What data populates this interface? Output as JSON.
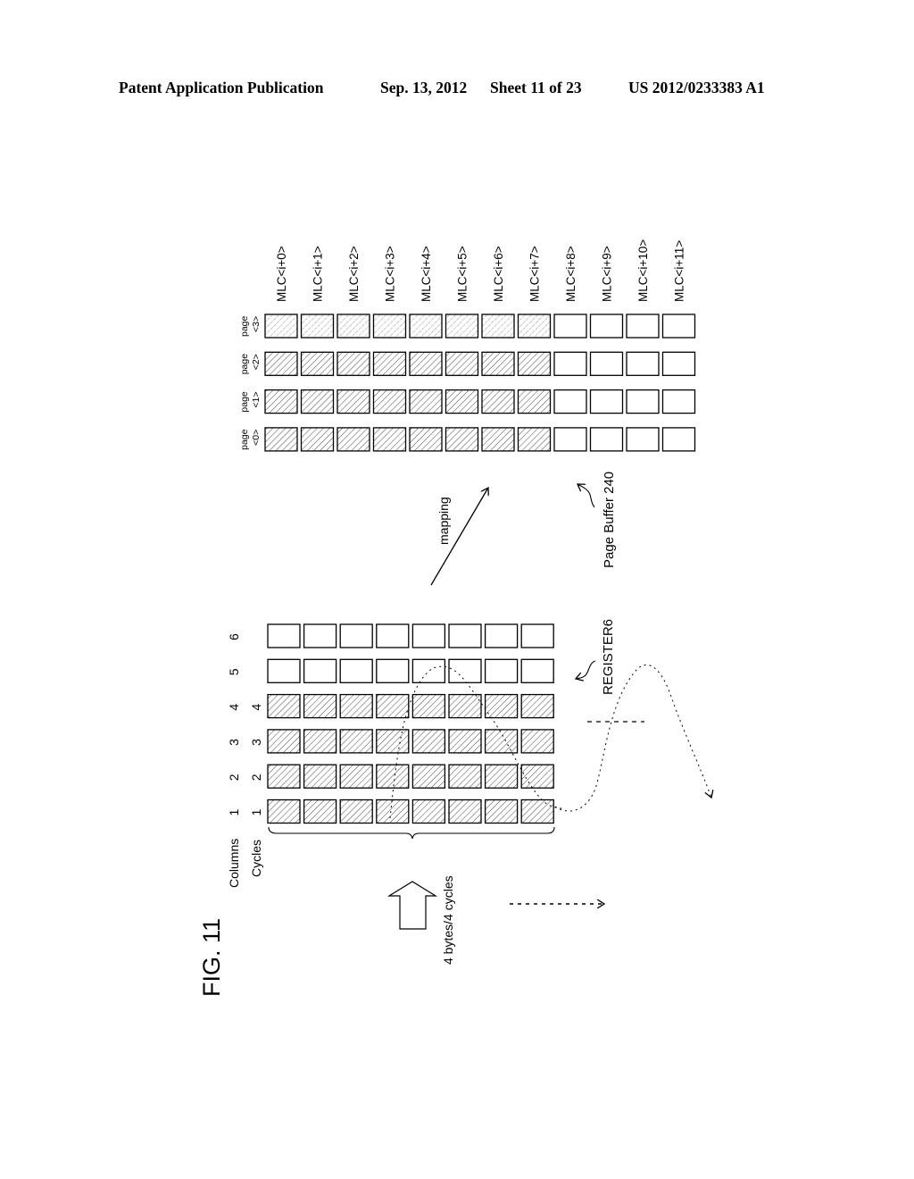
{
  "header": {
    "publication": "Patent Application Publication",
    "date": "Sep. 13, 2012",
    "sheet": "Sheet 11 of 23",
    "number": "US 2012/0233383 A1"
  },
  "figure": {
    "label": "FIG. 11",
    "orientation": "rotated 90° counter-clockwise",
    "page_buffer": {
      "label": "Page Buffer 240",
      "columns": [
        "MLC<i+0>",
        "MLC<i+1>",
        "MLC<i+2>",
        "MLC<i+3>",
        "MLC<i+4>",
        "MLC<i+5>",
        "MLC<i+6>",
        "MLC<i+7>",
        "MLC<i+8>",
        "MLC<i+9>",
        "MLC<i+10>",
        "MLC<i+11>"
      ],
      "rows": [
        {
          "label_top": "page",
          "label_bottom": "<3>",
          "filled_count": 8
        },
        {
          "label_top": "page",
          "label_bottom": "<2>",
          "filled_count": 8
        },
        {
          "label_top": "page",
          "label_bottom": "<1>",
          "filled_count": 8
        },
        {
          "label_top": "page",
          "label_bottom": "<0>",
          "filled_count": 8
        }
      ]
    },
    "mapping_label": "mapping",
    "register": {
      "label": "REGISTER6",
      "columns_label": "Columns",
      "cycles_label": "Cycles",
      "rows": [
        {
          "column": "6",
          "cycle": "",
          "filled": false
        },
        {
          "column": "5",
          "cycle": "",
          "filled": false
        },
        {
          "column": "4",
          "cycle": "4",
          "filled": true
        },
        {
          "column": "3",
          "cycle": "3",
          "filled": true
        },
        {
          "column": "2",
          "cycle": "2",
          "filled": true
        },
        {
          "column": "1",
          "cycle": "1",
          "filled": true
        }
      ],
      "cells_per_row": 8
    },
    "input_label": "4 bytes/4 cycles"
  },
  "colors": {
    "ink": "#000000",
    "hatch": "#555555",
    "background": "#ffffff"
  }
}
